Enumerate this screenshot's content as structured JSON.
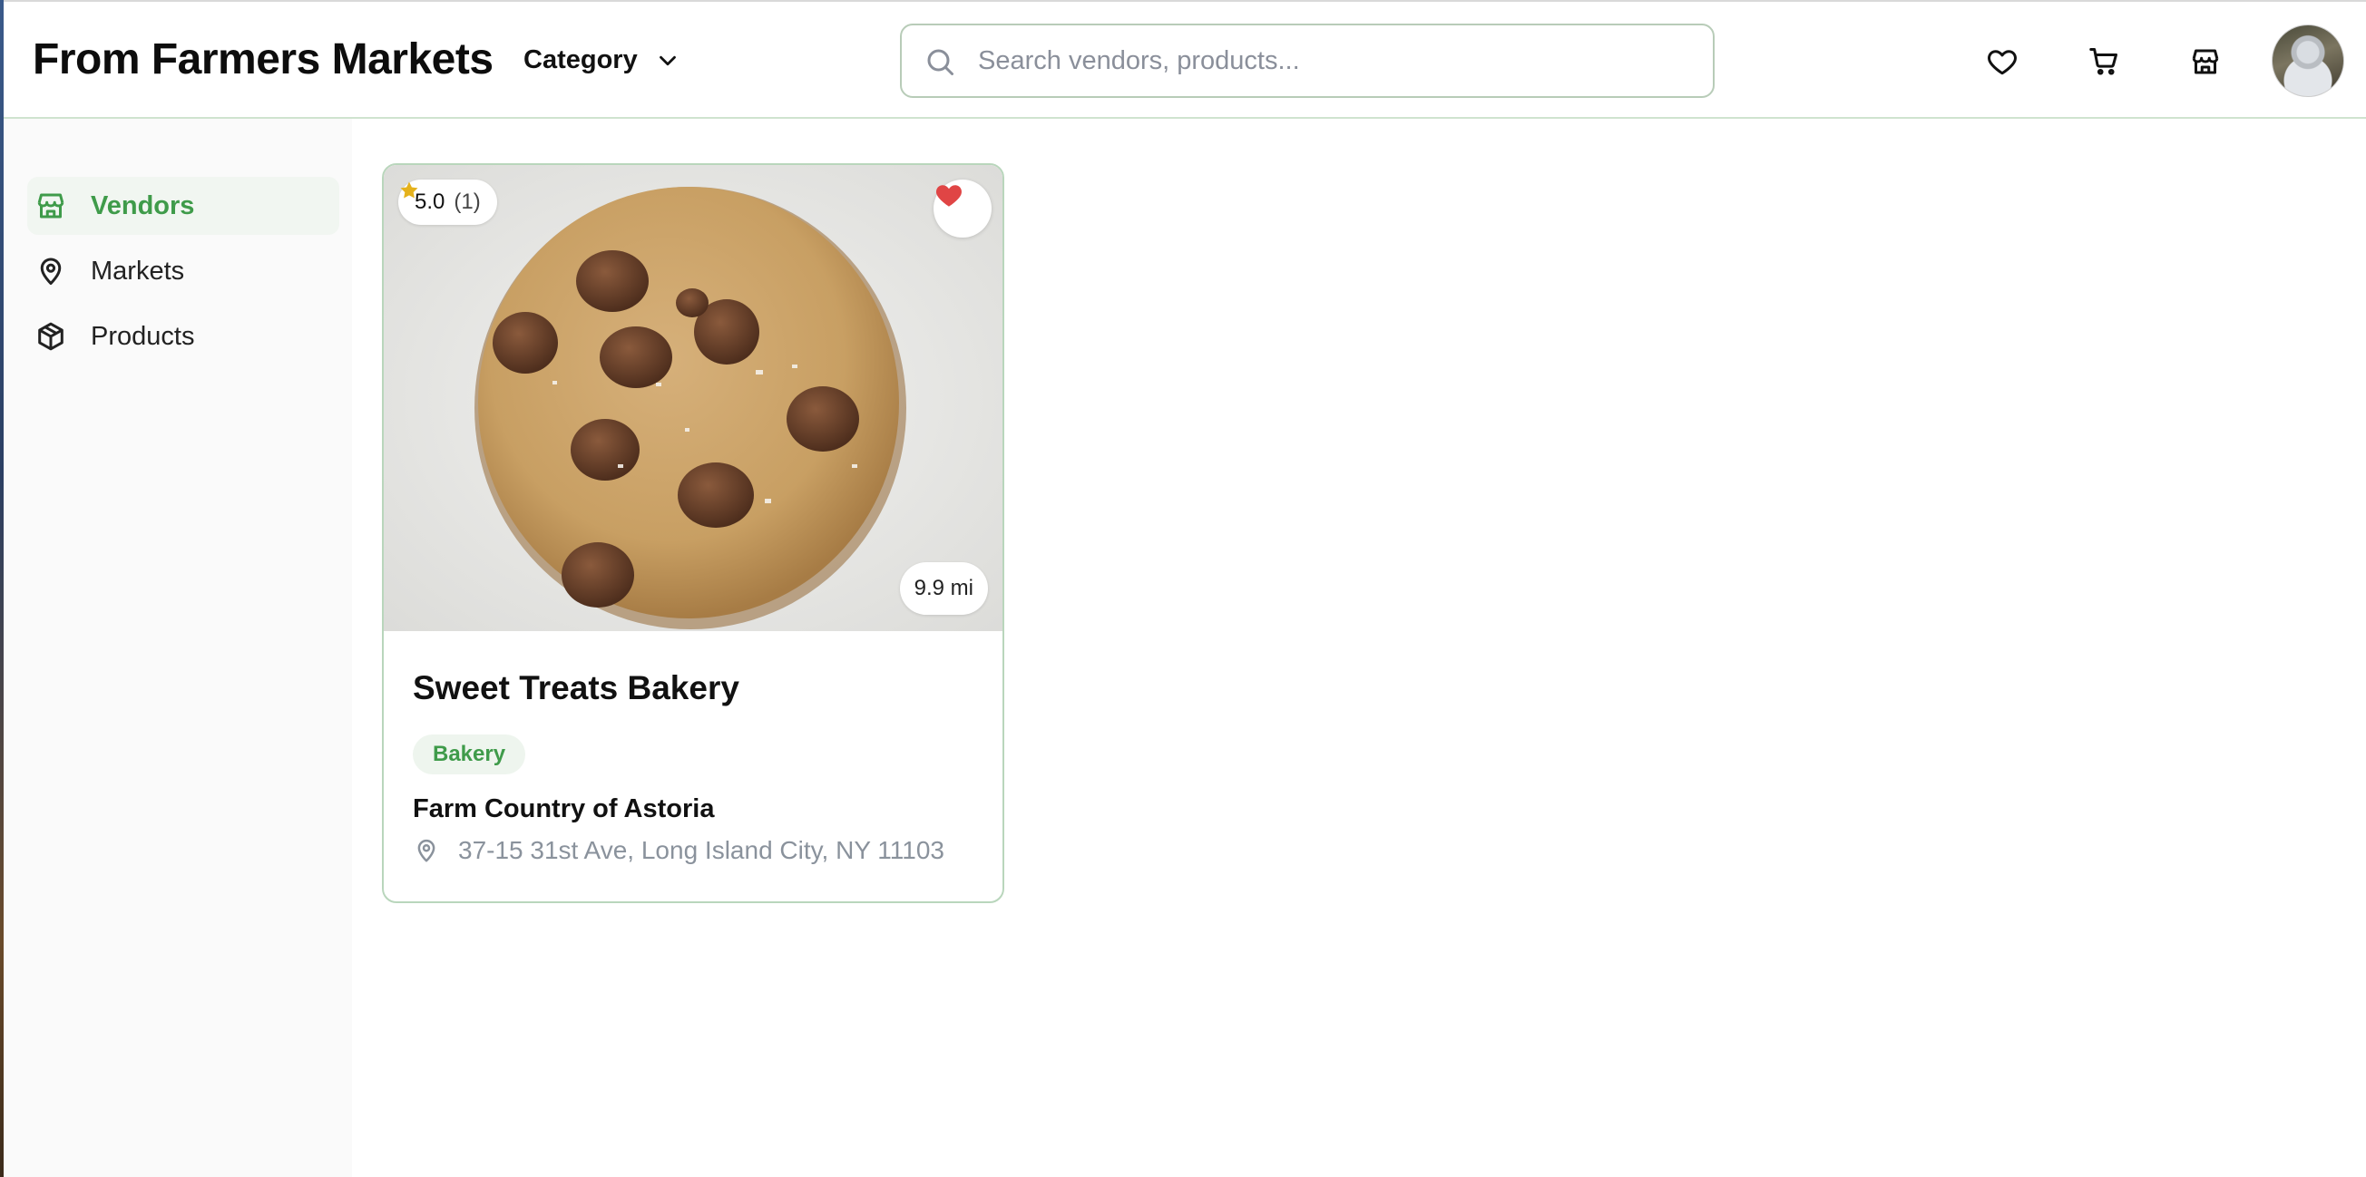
{
  "header": {
    "brand": "From Farmers Markets",
    "category_label": "Category",
    "search_placeholder": "Search vendors, products..."
  },
  "sidebar": {
    "items": [
      {
        "label": "Vendors",
        "icon": "store-icon",
        "active": true
      },
      {
        "label": "Markets",
        "icon": "map-pin-icon",
        "active": false
      },
      {
        "label": "Products",
        "icon": "package-icon",
        "active": false
      }
    ]
  },
  "vendor_card": {
    "rating": "5.0",
    "rating_count": "(1)",
    "favorited": true,
    "distance": "9.9 mi",
    "name": "Sweet Treats Bakery",
    "category": "Bakery",
    "market": "Farm Country of Astoria",
    "address": "37-15 31st Ave, Long Island City, NY 11103",
    "image": "chocolate-chip-cookie"
  },
  "colors": {
    "accent_green": "#3f9b4a",
    "tag_bg": "#eef5ee",
    "heart_red": "#e04545",
    "star_gold": "#e5b21c",
    "border_green": "#b9d6bc"
  }
}
